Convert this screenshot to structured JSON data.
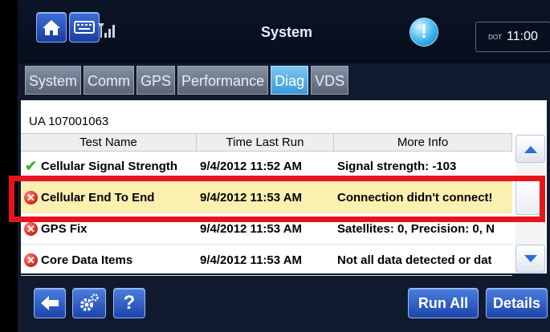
{
  "header": {
    "title": "System",
    "alert_icon": "alert-icon",
    "clock": {
      "dot_label": "DOT",
      "time": "11:00"
    }
  },
  "tabs": [
    {
      "label": "System",
      "active": false
    },
    {
      "label": "Comm",
      "active": false
    },
    {
      "label": "GPS",
      "active": false
    },
    {
      "label": "Performance",
      "active": false
    },
    {
      "label": "Diag",
      "active": true
    },
    {
      "label": "VDS",
      "active": false
    }
  ],
  "device_id": "UA 107001063",
  "table": {
    "columns": [
      "Test Name",
      "Time Last Run",
      "More Info"
    ],
    "rows": [
      {
        "status": "pass",
        "status_glyph": "✔",
        "name": "Cellular Signal Strength",
        "time": "9/4/2012 11:52 AM",
        "info": "Signal strength: -103"
      },
      {
        "status": "fail",
        "status_glyph": "✕",
        "name": "Cellular End To End",
        "time": "9/4/2012 11:53 AM",
        "info": "Connection didn't connect!"
      },
      {
        "status": "fail",
        "status_glyph": "✕",
        "name": "GPS Fix",
        "time": "9/4/2012 11:53 AM",
        "info": "Satellites: 0, Precision: 0, N"
      },
      {
        "status": "fail",
        "status_glyph": "✕",
        "name": "Core Data Items",
        "time": "9/4/2012 11:53 AM",
        "info": "Not all data detected or dat"
      }
    ],
    "selected_row": 1
  },
  "bottom": {
    "help_label": "?",
    "run_all_label": "Run All",
    "details_label": "Details"
  },
  "colors": {
    "accent": "#2a5bd0",
    "tab_active": "#3a98d6",
    "highlight": "#e8141b",
    "selected_row": "#fbf0b0",
    "fail": "#d2261c",
    "pass": "#3bb52c"
  }
}
